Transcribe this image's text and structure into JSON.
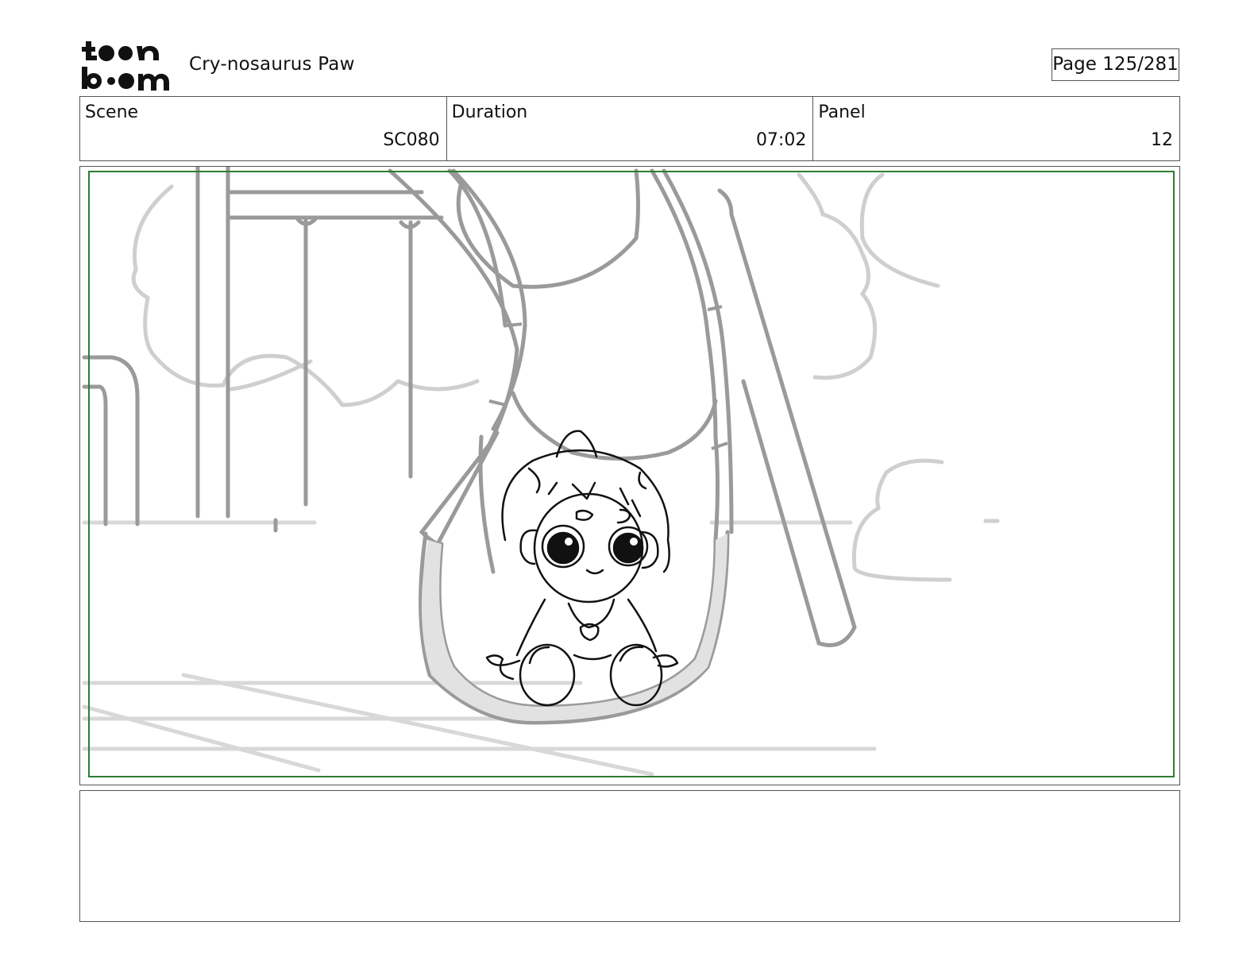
{
  "header": {
    "logo_text": "toon boom",
    "project_title": "Cry-nosaurus Paw",
    "page_indicator": "Page 125/281"
  },
  "info": {
    "scene": {
      "label": "Scene",
      "value": "SC080"
    },
    "duration": {
      "label": "Duration",
      "value": "07:02"
    },
    "panel": {
      "label": "Panel",
      "value": "12"
    }
  },
  "panel_image": {
    "description_icon": "storyboard-sketch-child-dino-costume-on-swing",
    "safe_frame_color": "#2e7d32"
  },
  "notes": {
    "text": ""
  }
}
